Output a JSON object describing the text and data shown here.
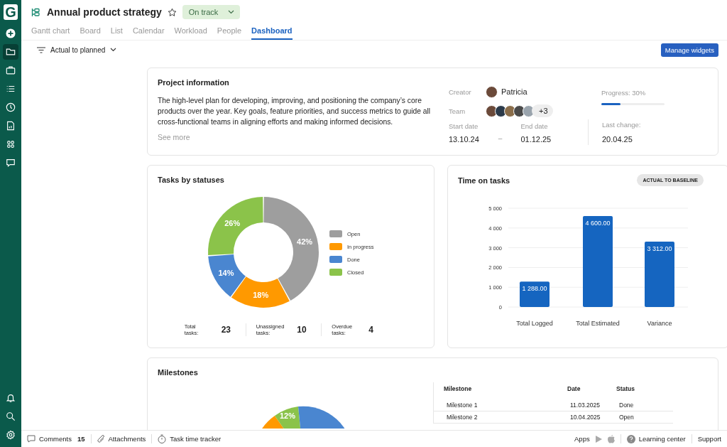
{
  "sidebar": {
    "logo": "G",
    "items": [
      {
        "kind": "add",
        "selected": false
      },
      {
        "kind": "folder",
        "selected": true
      },
      {
        "kind": "briefcase",
        "selected": false
      },
      {
        "kind": "list",
        "selected": false
      },
      {
        "kind": "clock",
        "selected": false
      },
      {
        "kind": "report",
        "selected": false
      },
      {
        "kind": "grid",
        "selected": false
      },
      {
        "kind": "chat",
        "selected": false
      }
    ],
    "bottom_items": [
      {
        "kind": "bell"
      },
      {
        "kind": "search"
      },
      {
        "kind": "settings"
      }
    ]
  },
  "project": {
    "title": "Annual product strategy",
    "status": "On track"
  },
  "tabs": [
    {
      "label": "Gantt chart",
      "selected": false
    },
    {
      "label": "Board",
      "selected": false
    },
    {
      "label": "List",
      "selected": false
    },
    {
      "label": "Calendar",
      "selected": false
    },
    {
      "label": "Workload",
      "selected": false
    },
    {
      "label": "People",
      "selected": false
    },
    {
      "label": "Dashboard",
      "selected": true
    }
  ],
  "toolbar": {
    "view": "Actual to planned",
    "button": "Manage widgets"
  },
  "project_info": {
    "title": "Project information",
    "description": "The high-level plan for developing, improving, and positioning the company’s core products over the year. Key goals, feature priorities, and success metrics to guide all cross-functional teams in aligning efforts and making informed decisions.",
    "see_more": "See more",
    "creator_label": "Creator",
    "creator": "Patricia",
    "team_label": "Team",
    "members": [
      {
        "kind": "avatar"
      },
      {
        "kind": "avatar"
      },
      {
        "kind": "avatar"
      },
      {
        "kind": "avatar"
      },
      {
        "kind": "avatar"
      }
    ],
    "team_more": "+3",
    "start_label": "Start date",
    "start": "13.10.24",
    "dash": "–",
    "end_label": "End date",
    "end": "01.12.25",
    "progress_label": "Progress: 30%",
    "level": 0.3,
    "last_change_label": "Last change:",
    "last_change": "20.04.25"
  },
  "tasks_by_statuses": {
    "title": "Tasks by statuses",
    "chart_data": {
      "type": "donut",
      "legend": "right",
      "categories": [
        "Open",
        "In progress",
        "Done",
        "Closed"
      ],
      "values": [
        42,
        18,
        14,
        26
      ],
      "value_labels": [
        "42%",
        "18%",
        "14%",
        "26%"
      ],
      "colors": [
        "#9e9e9e",
        "#ff9900",
        "#4a86d0",
        "#8bc34a"
      ]
    },
    "stats": [
      {
        "label": "Total tasks:",
        "value": "23"
      },
      {
        "label": "Unassigned tasks:",
        "value": "10"
      },
      {
        "label": "Overdue tasks:",
        "value": "4"
      }
    ]
  },
  "time_on_tasks": {
    "title": "Time on tasks",
    "badge": "ACTUAL TO BASELINE",
    "chart_data": {
      "type": "bar",
      "grid": true,
      "categories": [
        "Total Logged",
        "Total Estimated",
        "Variance"
      ],
      "ylim": [
        0,
        5000
      ],
      "yticks": [
        {
          "value": 0,
          "label": "0"
        },
        {
          "value": 1000,
          "label": "1 000"
        },
        {
          "value": 2000,
          "label": "2 000"
        },
        {
          "value": 3000,
          "label": "3 000"
        },
        {
          "value": 4000,
          "label": "4 000"
        },
        {
          "value": 5000,
          "label": "5 000"
        }
      ],
      "value_labels": [
        "1 288.00",
        "4 600.00",
        "3 312.00"
      ],
      "series": [
        {
          "color": "#1565c0",
          "values": [
            1288,
            4600,
            3312
          ]
        }
      ]
    }
  },
  "milestones": {
    "title": "Milestones",
    "slice_label": "12%",
    "columns": [
      "Milestone",
      "Date",
      "Status"
    ],
    "rows": [
      [
        "Milestone 1",
        "11.03.2025",
        "Done"
      ],
      [
        "Milestone 2",
        "10.04.2025",
        "Open"
      ]
    ]
  },
  "status_bar": {
    "comments": "Comments",
    "comments_count": "15",
    "attachments": "Attachments",
    "tracker": "Task time tracker",
    "apps": "Apps",
    "learning": "Learning center",
    "support": "Support"
  }
}
